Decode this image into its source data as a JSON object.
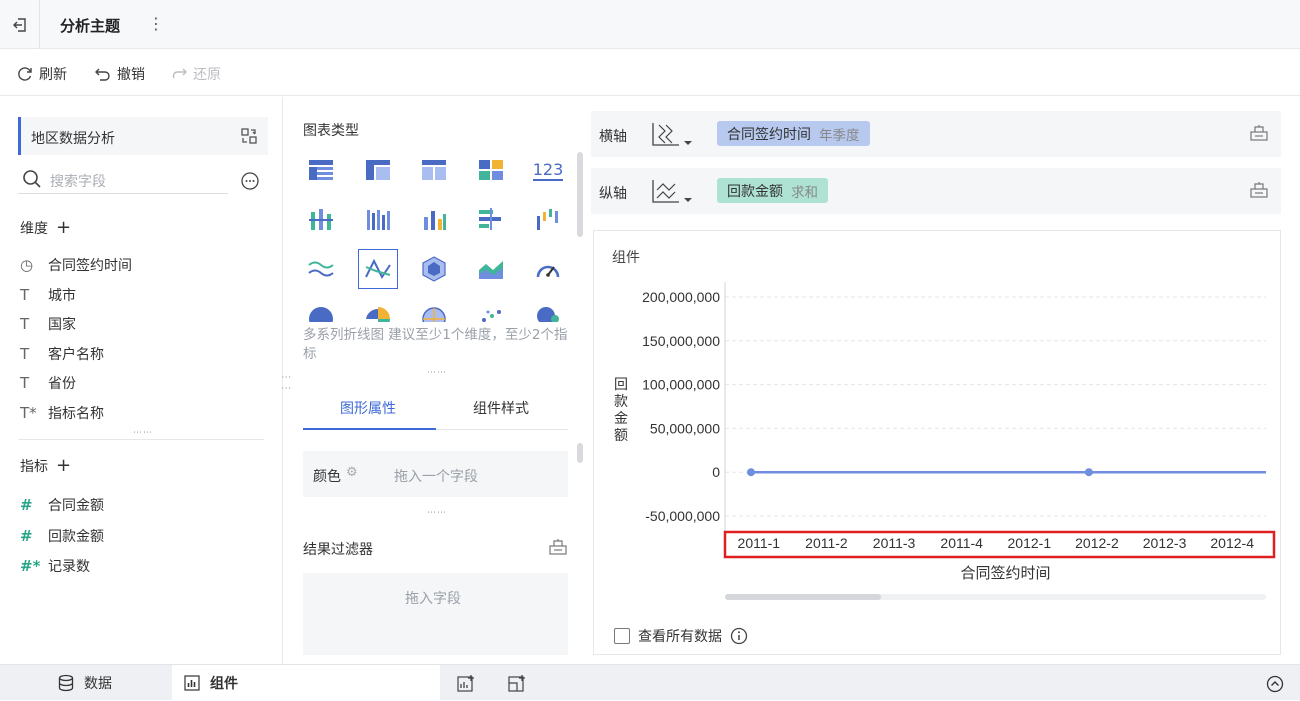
{
  "topbar": {
    "title": "分析主题",
    "more_icon": "more-vertical-icon",
    "back_icon": "exit-icon"
  },
  "toolbar": {
    "refresh": "刷新",
    "undo": "撤销",
    "redo": "还原"
  },
  "left": {
    "dataset": "地区数据分析",
    "search_placeholder": "搜索字段",
    "dimension_title": "维度",
    "dimensions": [
      {
        "icon": "clock-icon",
        "label": "合同签约时间"
      },
      {
        "icon": "text-icon",
        "label": "城市"
      },
      {
        "icon": "text-icon",
        "label": "国家"
      },
      {
        "icon": "text-icon",
        "label": "客户名称"
      },
      {
        "icon": "text-icon",
        "label": "省份"
      },
      {
        "icon": "text-star-icon",
        "label": "指标名称"
      }
    ],
    "measure_title": "指标",
    "measures": [
      {
        "icon": "hash-icon",
        "label": "合同金额"
      },
      {
        "icon": "hash-icon",
        "label": "回款金额"
      },
      {
        "icon": "hash-star-icon",
        "label": "记录数"
      }
    ]
  },
  "mid": {
    "chart_type_label": "图表类型",
    "hint": "多系列折线图 建议至少1个维度，至少2个指标",
    "tabs": [
      "图形属性",
      "组件样式"
    ],
    "color_label": "颜色",
    "color_placeholder": "拖入一个字段",
    "filter_title": "结果过滤器",
    "filter_placeholder": "拖入字段",
    "kpi_icon_text": "123"
  },
  "axes": {
    "x_label": "横轴",
    "x_field": "合同签约时间",
    "x_sub": "年季度",
    "y_label": "纵轴",
    "y_field": "回款金额",
    "y_sub": "求和"
  },
  "component": {
    "title": "组件",
    "show_all": "查看所有数据"
  },
  "chart_data": {
    "type": "line",
    "categories": [
      "2011-1",
      "2011-2",
      "2011-3",
      "2011-4",
      "2012-1",
      "2012-2",
      "2012-3",
      "2012-4"
    ],
    "series": [
      {
        "name": "回款金额",
        "values": [
          0,
          0,
          0,
          0,
          0,
          0,
          0,
          0
        ]
      }
    ],
    "yticks": [
      "200,000,000",
      "150,000,000",
      "100,000,000",
      "50,000,000",
      "0",
      "-50,000,000"
    ],
    "ylim": [
      -50000000,
      200000000
    ],
    "xlabel": "合同签约时间",
    "ylabel": "回款金额",
    "colors": {
      "line": "#6f8ee0",
      "highlight_box": "#e02020"
    }
  },
  "bottom": {
    "data_tab": "数据",
    "component_tab": "组件"
  }
}
